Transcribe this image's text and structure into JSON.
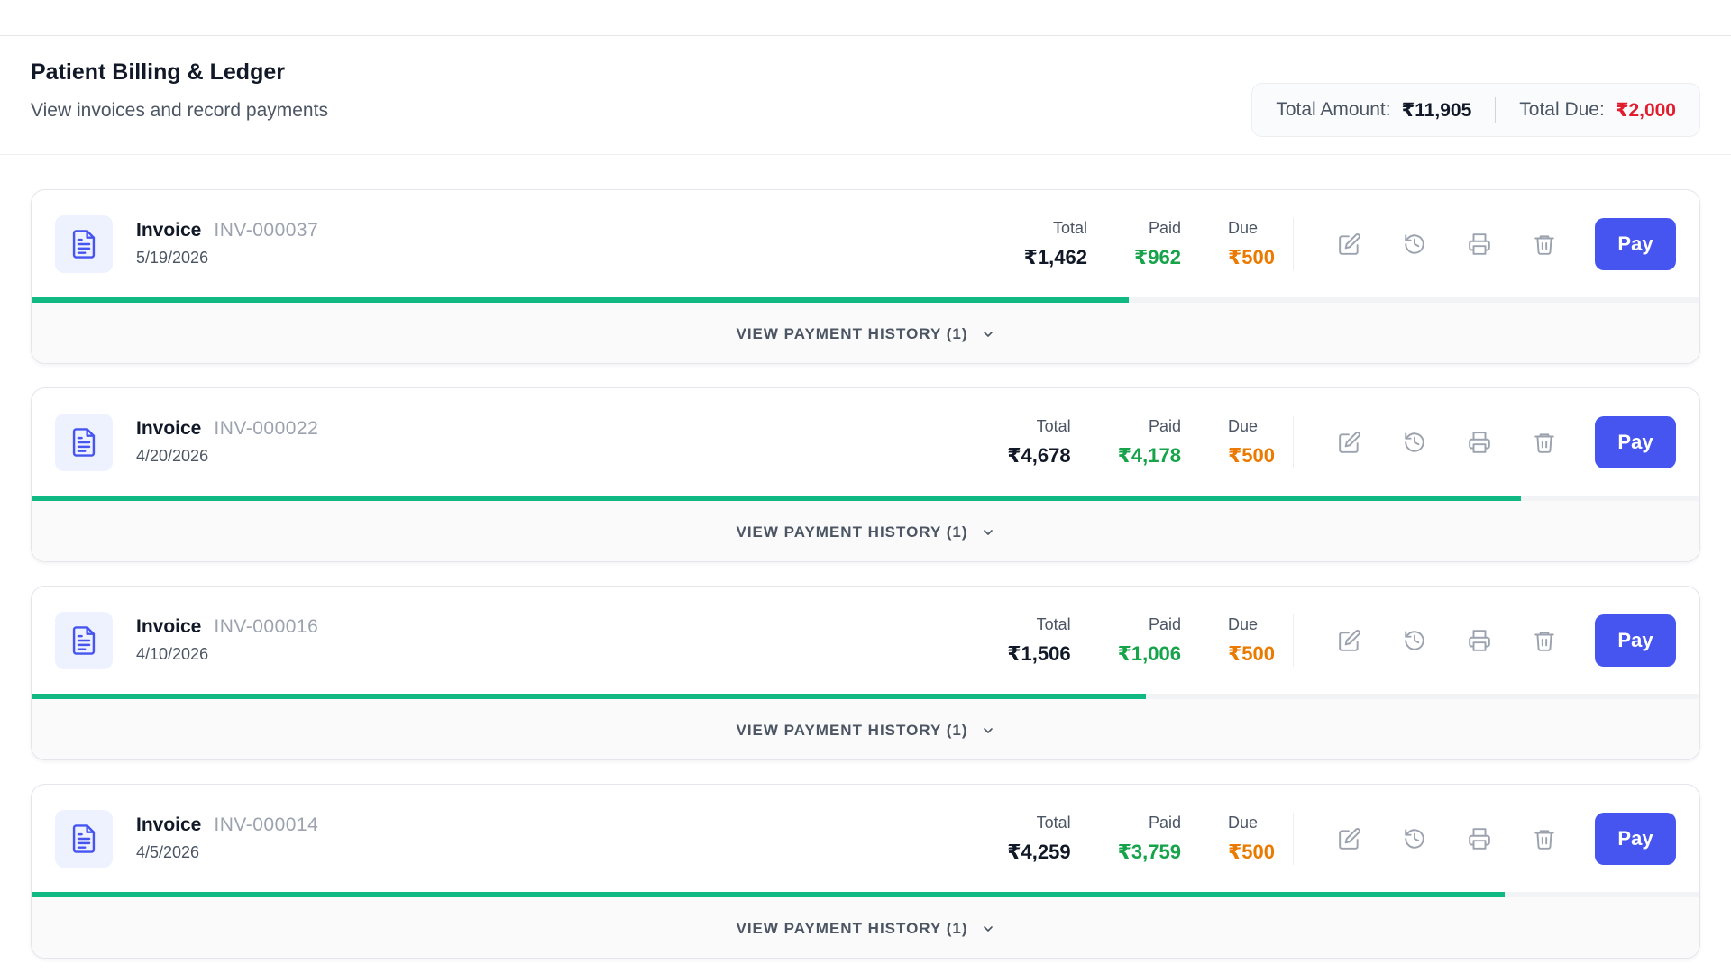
{
  "header": {
    "title": "Patient Billing & Ledger",
    "subtitle": "View invoices and record payments",
    "total_amount_label": "Total Amount:",
    "total_amount_value": "₹11,905",
    "total_due_label": "Total Due:",
    "total_due_value": "₹2,000"
  },
  "labels": {
    "invoice_word": "Invoice",
    "total": "Total",
    "paid": "Paid",
    "due": "Due",
    "pay": "Pay",
    "history": "VIEW PAYMENT HISTORY (1)"
  },
  "icons": {
    "file": "file-text-icon",
    "edit": "edit-icon",
    "history": "history-icon",
    "print": "printer-icon",
    "delete": "trash-icon",
    "chevron": "chevron-down-icon"
  },
  "colors": {
    "accent": "#4654f0",
    "paid": "#16a34a",
    "due": "#ea7a00",
    "total_due": "#e11d2e",
    "progress": "#10b981"
  },
  "invoices": [
    {
      "number": "INV-000037",
      "date": "5/19/2026",
      "total": "₹1,462",
      "paid": "₹962",
      "due": "₹500",
      "paid_fraction": 0.658
    },
    {
      "number": "INV-000022",
      "date": "4/20/2026",
      "total": "₹4,678",
      "paid": "₹4,178",
      "due": "₹500",
      "paid_fraction": 0.893
    },
    {
      "number": "INV-000016",
      "date": "4/10/2026",
      "total": "₹1,506",
      "paid": "₹1,006",
      "due": "₹500",
      "paid_fraction": 0.668
    },
    {
      "number": "INV-000014",
      "date": "4/5/2026",
      "total": "₹4,259",
      "paid": "₹3,759",
      "due": "₹500",
      "paid_fraction": 0.883
    }
  ]
}
